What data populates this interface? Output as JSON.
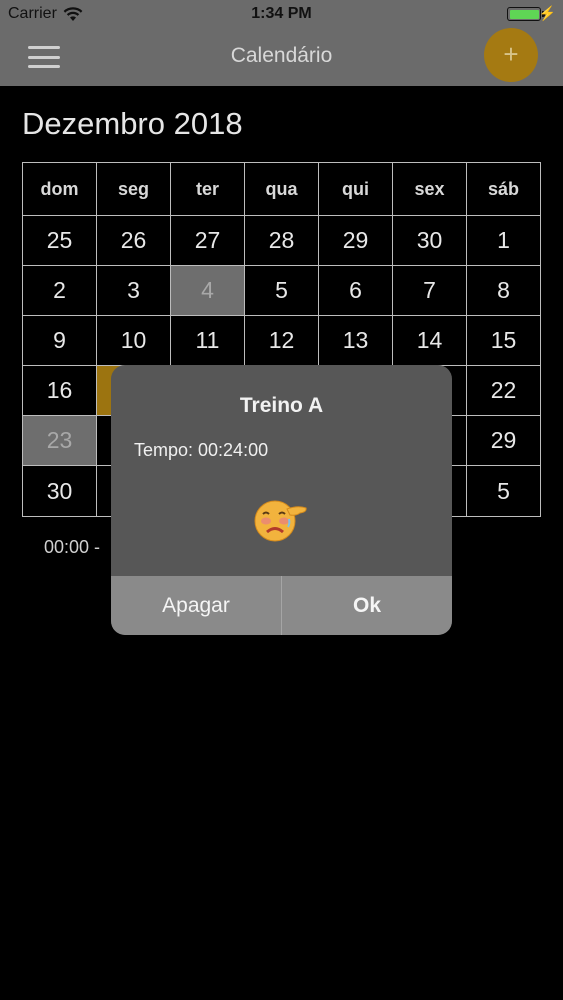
{
  "status_bar": {
    "carrier": "Carrier",
    "time": "1:34 PM"
  },
  "nav": {
    "title": "Calendário",
    "add_label": "+"
  },
  "calendar": {
    "month_title": "Dezembro 2018",
    "weekdays": [
      "dom",
      "seg",
      "ter",
      "qua",
      "qui",
      "sex",
      "sáb"
    ],
    "weeks": [
      [
        "25",
        "26",
        "27",
        "28",
        "29",
        "30",
        "1"
      ],
      [
        "2",
        "3",
        "4",
        "5",
        "6",
        "7",
        "8"
      ],
      [
        "9",
        "10",
        "11",
        "12",
        "13",
        "14",
        "15"
      ],
      [
        "16",
        "",
        "",
        "",
        "",
        "",
        "22"
      ],
      [
        "23",
        "",
        "",
        "",
        "",
        "",
        "29"
      ],
      [
        "30",
        "",
        "",
        "",
        "",
        "",
        "5"
      ]
    ],
    "highlighted_day": "4",
    "selected_day": "23",
    "accent_color": "#9c7410"
  },
  "times_text": "00:00 -",
  "modal": {
    "title": "Treino A",
    "message": "Tempo: 00:24:00",
    "icon": "sad-face-emoji-icon",
    "delete_label": "Apagar",
    "ok_label": "Ok"
  }
}
